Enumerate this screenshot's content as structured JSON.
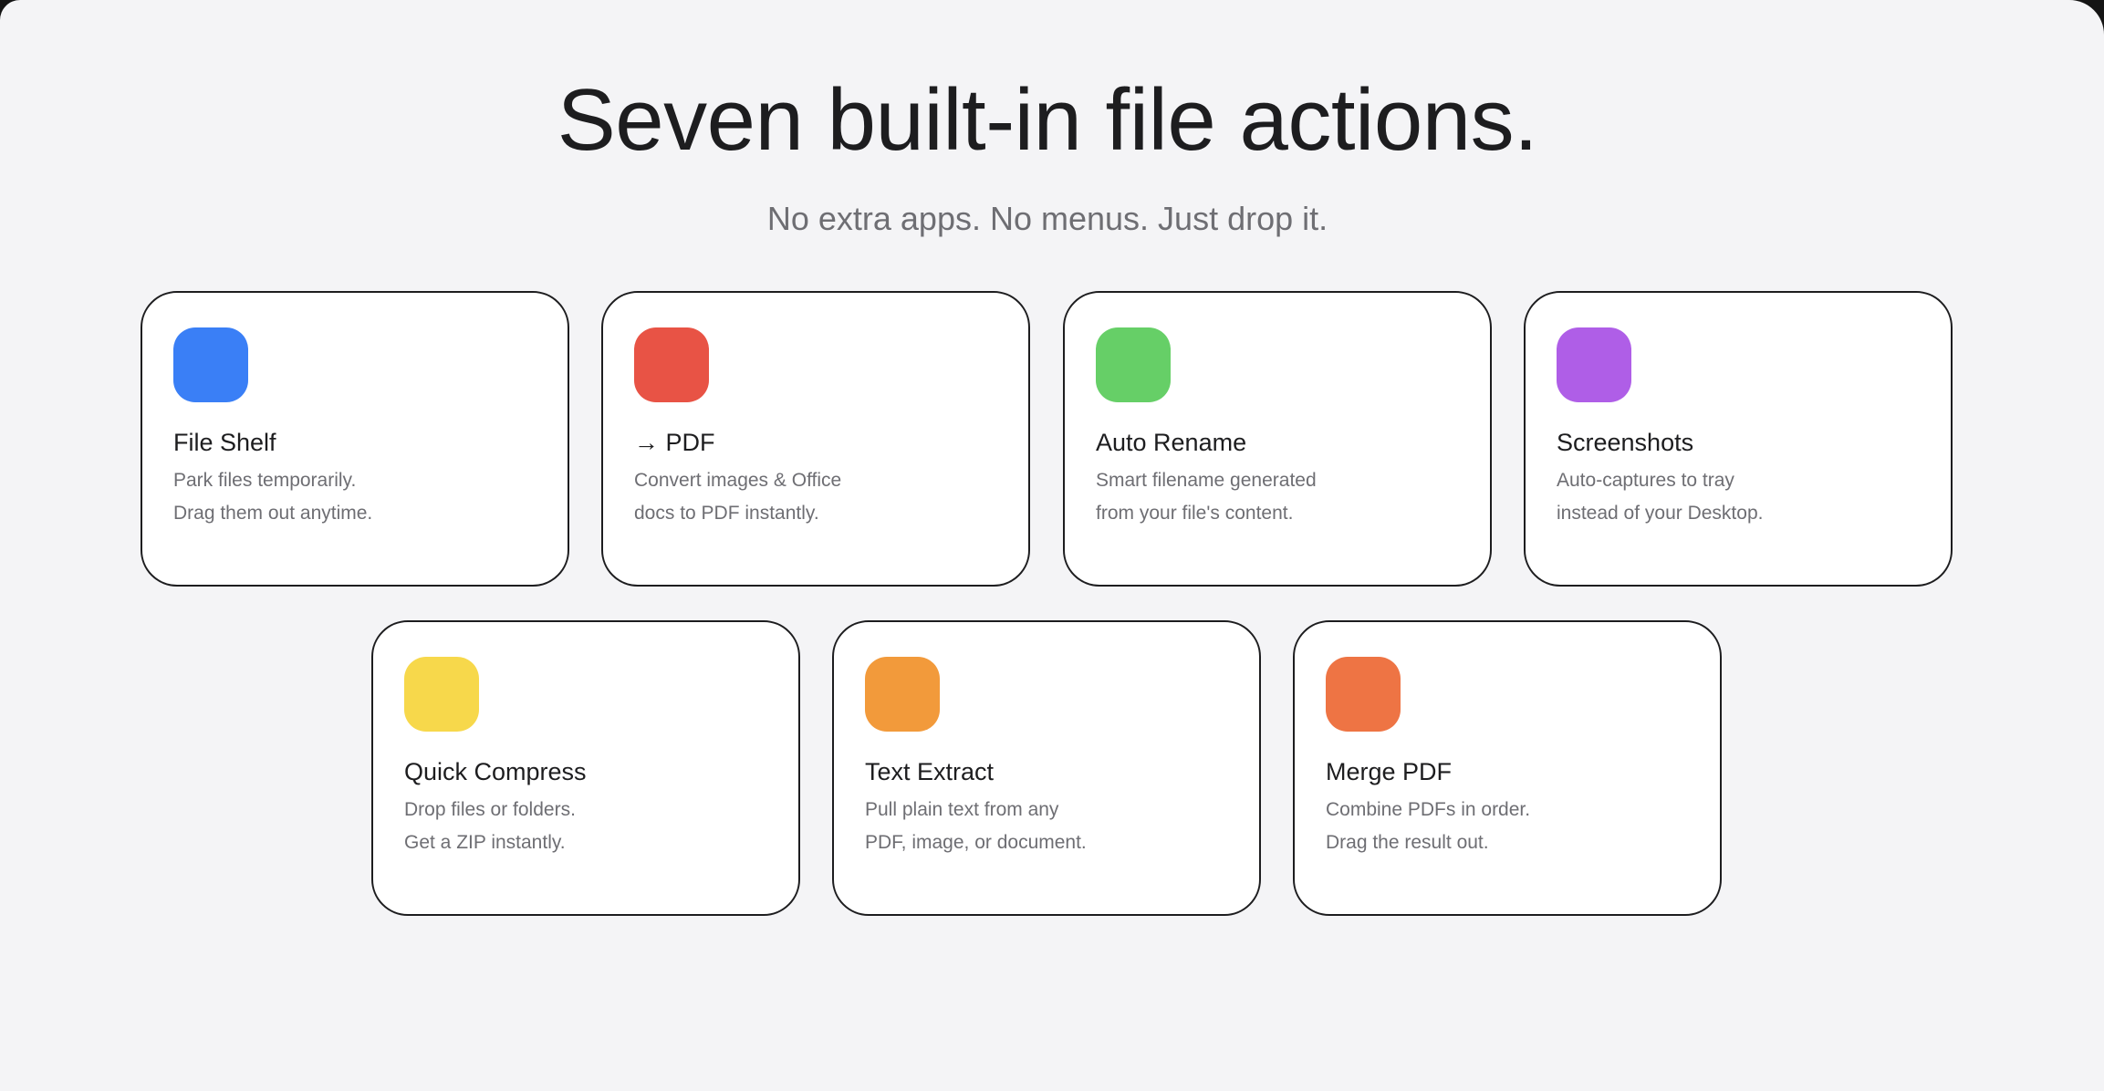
{
  "header": {
    "title": "Seven built-in file actions.",
    "subtitle": "No extra apps. No menus. Just drop it."
  },
  "cards": [
    {
      "title": "File Shelf",
      "line1": "Park files temporarily.",
      "line2": "Drag them out anytime.",
      "icon": "file-shelf-icon",
      "color": "#3a7ff6"
    },
    {
      "title": "→ PDF",
      "line1": "Convert images & Office",
      "line2": "docs to PDF instantly.",
      "icon": "to-pdf-icon",
      "color": "#e85345"
    },
    {
      "title": "Auto Rename",
      "line1": "Smart filename generated",
      "line2": "from your file's content.",
      "icon": "auto-rename-icon",
      "color": "#66cf67"
    },
    {
      "title": "Screenshots",
      "line1": "Auto-captures to tray",
      "line2": "instead of your Desktop.",
      "icon": "screenshots-icon",
      "color": "#af5ee7"
    },
    {
      "title": "Quick Compress",
      "line1": "Drop files or folders.",
      "line2": "Get a ZIP instantly.",
      "icon": "quick-compress-icon",
      "color": "#f7d84b"
    },
    {
      "title": "Text Extract",
      "line1": "Pull plain text from any",
      "line2": "PDF, image, or document.",
      "icon": "text-extract-icon",
      "color": "#f29a3b"
    },
    {
      "title": "Merge PDF",
      "line1": "Combine PDFs in order.",
      "line2": "Drag the result out.",
      "icon": "merge-pdf-icon",
      "color": "#ee7444"
    }
  ]
}
